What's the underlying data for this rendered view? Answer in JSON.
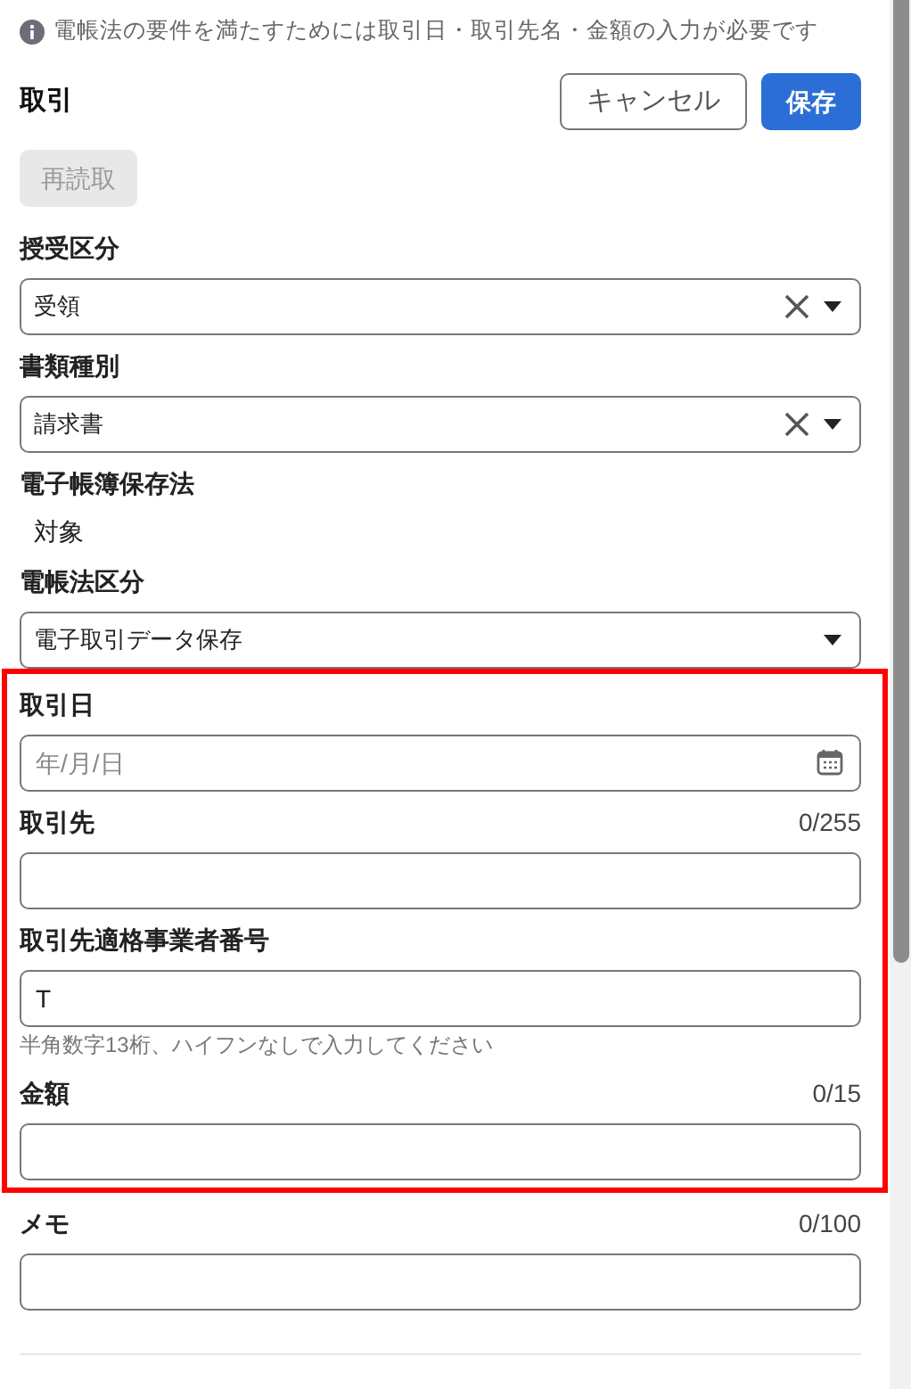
{
  "notice": "電帳法の要件を満たすためには取引日・取引先名・金額の入力が必要です",
  "header": {
    "title": "取引",
    "buttons": [
      {
        "label": "キャンセル",
        "kind": "secondary"
      },
      {
        "label": "保存",
        "kind": "primary"
      }
    ]
  },
  "reread_button": {
    "label": "再読取",
    "disabled": true
  },
  "fields": [
    {
      "kind": "select",
      "label": "授受区分",
      "value": "受領",
      "clearable": true
    },
    {
      "kind": "select",
      "label": "書類種別",
      "value": "請求書",
      "clearable": true
    },
    {
      "kind": "static",
      "label": "電子帳簿保存法",
      "value": "対象"
    },
    {
      "kind": "select",
      "label": "電帳法区分",
      "value": "電子取引データ保存",
      "clearable": false
    }
  ],
  "highlight_box": {
    "fields": [
      {
        "kind": "date",
        "label": "取引日",
        "placeholder": "年/月/日"
      },
      {
        "kind": "text",
        "label": "取引先",
        "counter": "0/255"
      },
      {
        "kind": "text",
        "label": "取引先適格事業者番号",
        "value": "T",
        "hint": "半角数字13桁、ハイフンなしで入力してください"
      },
      {
        "kind": "text",
        "label": "金額",
        "counter": "0/15"
      }
    ]
  },
  "fields_after": [
    {
      "kind": "text",
      "label": "メモ",
      "counter": "0/100"
    }
  ]
}
